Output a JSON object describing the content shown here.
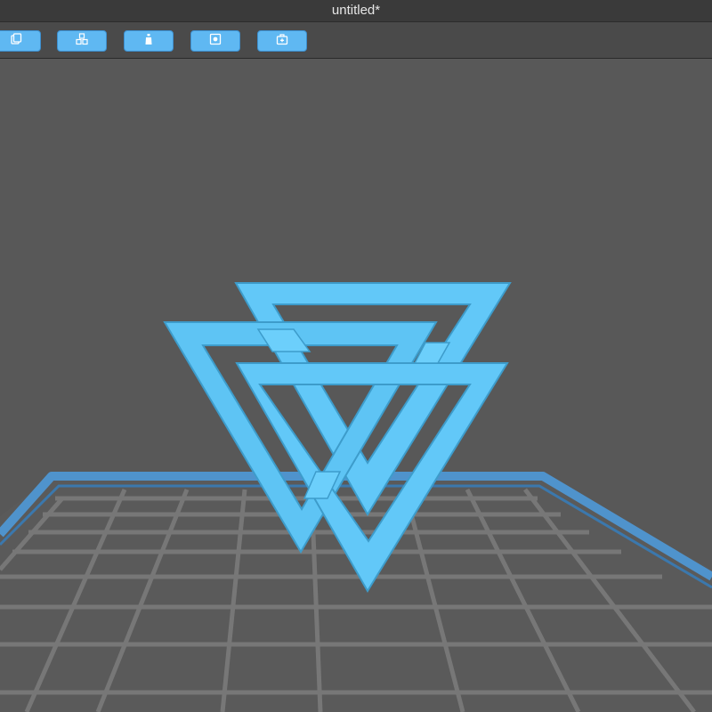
{
  "window": {
    "title": "untitled*"
  },
  "toolbar": {
    "buttons": [
      {
        "icon": "copy-icon"
      },
      {
        "icon": "cubes-icon"
      },
      {
        "icon": "bottle-icon"
      },
      {
        "icon": "square-dot-icon"
      },
      {
        "icon": "toolbox-icon"
      }
    ]
  },
  "scene": {
    "model_color": "#62c8f8",
    "bed_border_color": "#4f93cc",
    "grid_color": "#7a7a7a"
  }
}
